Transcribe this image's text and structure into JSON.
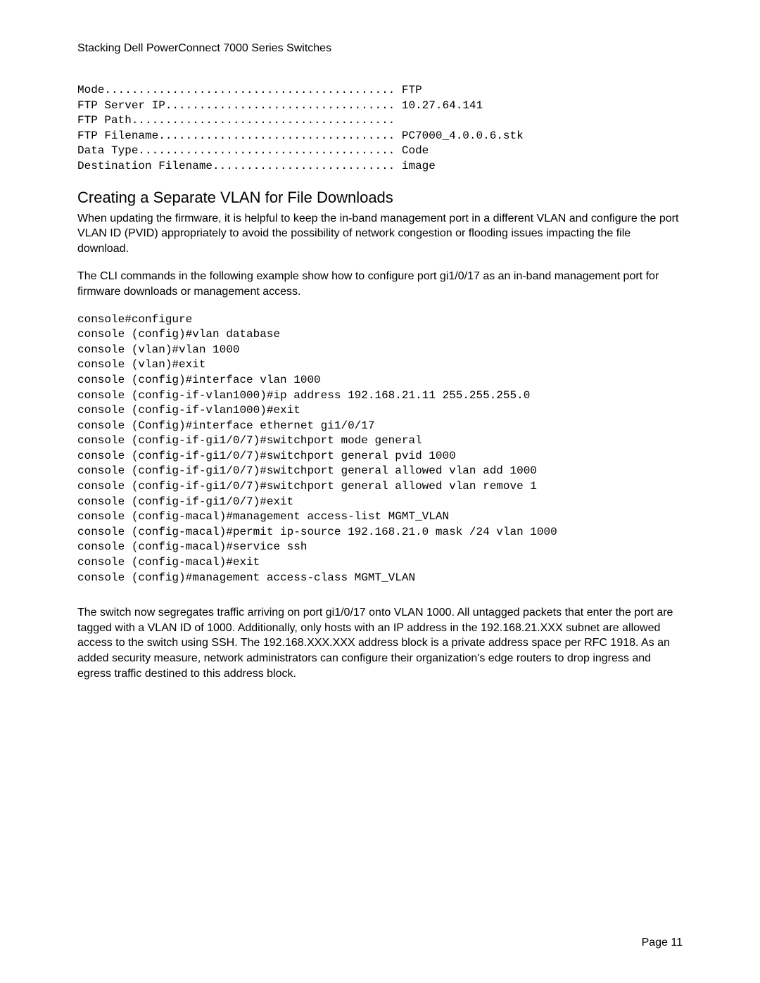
{
  "header": {
    "title": "Stacking Dell PowerConnect 7000 Series Switches"
  },
  "config_output": "Mode........................................... FTP\nFTP Server IP.................................. 10.27.64.141\nFTP Path.......................................\nFTP Filename................................... PC7000_4.0.0.6.stk\nData Type...................................... Code\nDestination Filename........................... image",
  "section": {
    "heading": "Creating a Separate VLAN for File Downloads",
    "para1": "When updating the firmware, it is helpful to keep the in-band management port in a different VLAN and configure the port VLAN ID (PVID) appropriately to avoid the possibility of network congestion or flooding issues impacting the file download.",
    "para2": "The CLI commands in the following example show how to configure port gi1/0/17 as an in-band management port for firmware downloads or management access.",
    "cli": "console#configure\nconsole (config)#vlan database\nconsole (vlan)#vlan 1000\nconsole (vlan)#exit\nconsole (config)#interface vlan 1000\nconsole (config-if-vlan1000)#ip address 192.168.21.11 255.255.255.0\nconsole (config-if-vlan1000)#exit\nconsole (Config)#interface ethernet gi1/0/17\nconsole (config-if-gi1/0/7)#switchport mode general\nconsole (config-if-gi1/0/7)#switchport general pvid 1000\nconsole (config-if-gi1/0/7)#switchport general allowed vlan add 1000\nconsole (config-if-gi1/0/7)#switchport general allowed vlan remove 1\nconsole (config-if-gi1/0/7)#exit\nconsole (config-macal)#management access-list MGMT_VLAN\nconsole (config-macal)#permit ip-source 192.168.21.0 mask /24 vlan 1000\nconsole (config-macal)#service ssh\nconsole (config-macal)#exit\nconsole (config)#management access-class MGMT_VLAN",
    "para3": "The switch now segregates traffic arriving on port gi1/0/17 onto VLAN 1000. All untagged packets that enter the port are tagged with a VLAN ID of 1000. Additionally, only hosts with an IP address in the 192.168.21.XXX subnet are allowed access to the switch using SSH. The 192.168.XXX.XXX address block is a private address space per RFC 1918. As an added security measure, network administrators can configure their organization's edge routers to drop ingress and egress traffic destined to this address block."
  },
  "footer": {
    "page_label": "Page 11"
  }
}
